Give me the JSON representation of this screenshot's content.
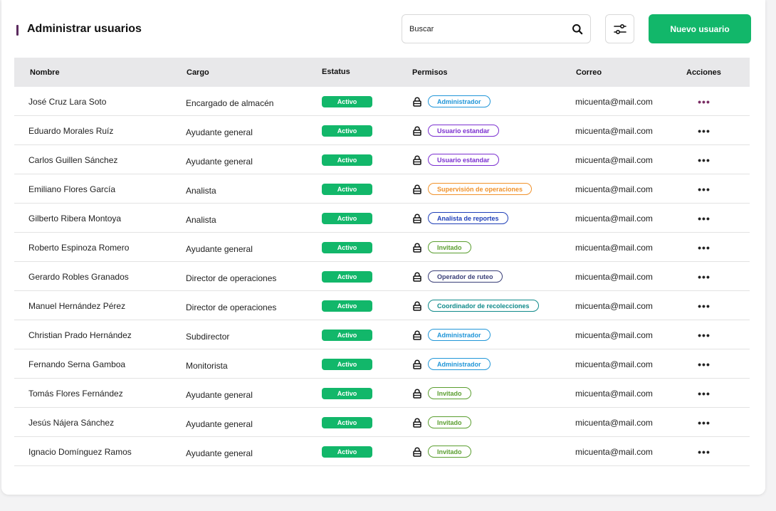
{
  "header": {
    "title": "Administrar usuarios",
    "search_placeholder": "Buscar",
    "new_user_label": "Nuevo usuario"
  },
  "colors": {
    "accent": "#12b76a",
    "title_marker": "#5b2a5e",
    "header_row": "#e8e8ea"
  },
  "icons": {
    "search": "search-icon",
    "filter": "sliders-icon",
    "lock": "lock-icon",
    "actions": "more-horizontal-icon"
  },
  "table": {
    "columns": [
      "Nombre",
      "Cargo",
      "Estatus",
      "Permisos",
      "Correo",
      "Acciones"
    ],
    "rows": [
      {
        "name": "José Cruz Lara Soto",
        "role": "Encargado de almacén",
        "status": "Activo",
        "permission": "Administrador",
        "perm_color": "#2196d8",
        "email": "micuenta@mail.com",
        "actions": "•••",
        "actions_color": "#7a2c63"
      },
      {
        "name": "Eduardo Morales Ruíz",
        "role": "Ayudante general",
        "status": "Activo",
        "permission": "Usuario estandar",
        "perm_color": "#7b2fd0",
        "email": "micuenta@mail.com",
        "actions": "•••",
        "actions_color": "#222222"
      },
      {
        "name": "Carlos Guillen Sánchez",
        "role": "Ayudante general",
        "status": "Activo",
        "permission": "Usuario estandar",
        "perm_color": "#7b2fd0",
        "email": "micuenta@mail.com",
        "actions": "•••",
        "actions_color": "#222222"
      },
      {
        "name": "Emiliano Flores García",
        "role": "Analista",
        "status": "Activo",
        "permission": "Supervisión de operaciones",
        "perm_color": "#f0922b",
        "email": "micuenta@mail.com",
        "actions": "•••",
        "actions_color": "#222222"
      },
      {
        "name": "Gilberto Ribera Montoya",
        "role": "Analista",
        "status": "Activo",
        "permission": "Analista de reportes",
        "perm_color": "#1f3fb8",
        "email": "micuenta@mail.com",
        "actions": "•••",
        "actions_color": "#222222"
      },
      {
        "name": "Roberto Espinoza Romero",
        "role": "Ayudante general",
        "status": "Activo",
        "permission": "Invitado",
        "perm_color": "#5a9e2f",
        "email": "micuenta@mail.com",
        "actions": "•••",
        "actions_color": "#222222"
      },
      {
        "name": "Gerardo Robles Granados",
        "role": "Director de operaciones",
        "status": "Activo",
        "permission": "Operador de ruteo",
        "perm_color": "#3a3f78",
        "email": "micuenta@mail.com",
        "actions": "•••",
        "actions_color": "#222222"
      },
      {
        "name": "Manuel Hernández Pérez",
        "role": "Director de operaciones",
        "status": "Activo",
        "permission": "Coordinador de recolecciones",
        "perm_color": "#0f8a8a",
        "email": "micuenta@mail.com",
        "actions": "•••",
        "actions_color": "#222222"
      },
      {
        "name": "Christian Prado Hernández",
        "role": "Subdirector",
        "status": "Activo",
        "permission": "Administrador",
        "perm_color": "#2196d8",
        "email": "micuenta@mail.com",
        "actions": "•••",
        "actions_color": "#222222"
      },
      {
        "name": "Fernando Serna Gamboa",
        "role": "Monitorista",
        "status": "Activo",
        "permission": "Administrador",
        "perm_color": "#2196d8",
        "email": "micuenta@mail.com",
        "actions": "•••",
        "actions_color": "#222222"
      },
      {
        "name": "Tomás Flores Fernández",
        "role": "Ayudante general",
        "status": "Activo",
        "permission": "Invitado",
        "perm_color": "#5a9e2f",
        "email": "micuenta@mail.com",
        "actions": "•••",
        "actions_color": "#222222"
      },
      {
        "name": "Jesús Nájera Sánchez",
        "role": "Ayudante general",
        "status": "Activo",
        "permission": "Invitado",
        "perm_color": "#5a9e2f",
        "email": "micuenta@mail.com",
        "actions": "•••",
        "actions_color": "#222222"
      },
      {
        "name": "Ignacio Domínguez Ramos",
        "role": "Ayudante general",
        "status": "Activo",
        "permission": "Invitado",
        "perm_color": "#5a9e2f",
        "email": "micuenta@mail.com",
        "actions": "•••",
        "actions_color": "#222222"
      }
    ]
  }
}
